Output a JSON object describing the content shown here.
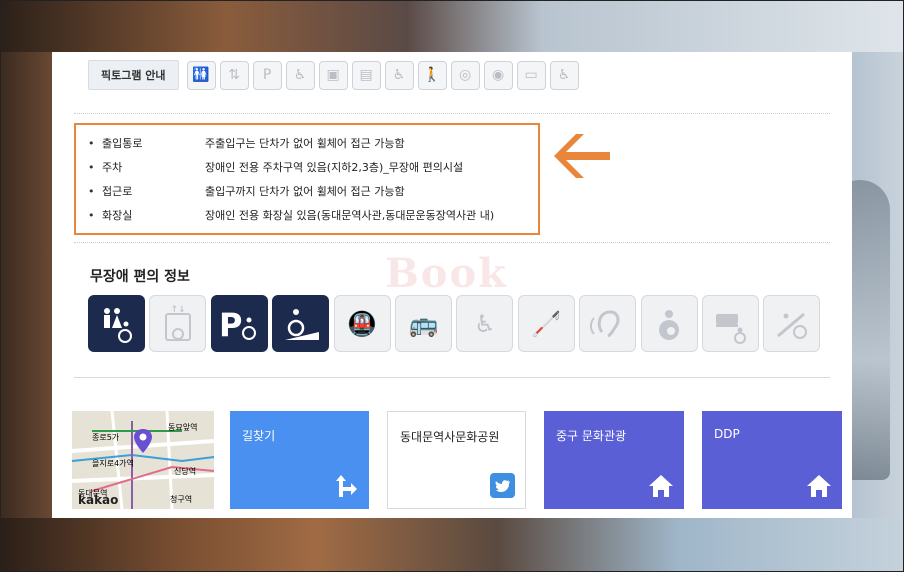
{
  "pictogram": {
    "button_label": "픽토그램 안내",
    "icons": [
      "restroom-icon",
      "elevator-icon",
      "parking-icon",
      "ramp-icon",
      "subway-icon",
      "bus-icon",
      "counter-icon",
      "blind-icon",
      "hearing-icon",
      "nursing-icon",
      "bed-icon",
      "playground-icon"
    ]
  },
  "info": {
    "rows": [
      {
        "label": "출입통로",
        "value": "주출입구는 단차가 없어 휠체어 접근 가능함"
      },
      {
        "label": "주차",
        "value": "장애인 전용 주차구역 있음(지하2,3층)_무장애 편의시설"
      },
      {
        "label": "접근로",
        "value": "출입구까지 단차가 없어 휠체어 접근 가능함"
      },
      {
        "label": "화장실",
        "value": "장애인 전용 화장실 있음(동대문역사관,동대문운동장역사관 내)"
      }
    ]
  },
  "accessibility": {
    "title": "무장애 편의 정보",
    "watermark": "Book",
    "icons": [
      {
        "name": "restroom-icon",
        "active": true,
        "glyph": "🚻"
      },
      {
        "name": "elevator-icon",
        "active": false,
        "glyph": "⇅"
      },
      {
        "name": "parking-icon",
        "active": true,
        "glyph": "P♿"
      },
      {
        "name": "ramp-icon",
        "active": true,
        "glyph": "♿"
      },
      {
        "name": "subway-icon",
        "active": false,
        "glyph": "🚇"
      },
      {
        "name": "bus-icon",
        "active": false,
        "glyph": "🚌"
      },
      {
        "name": "counter-icon",
        "active": false,
        "glyph": "♿"
      },
      {
        "name": "blind-icon",
        "active": false,
        "glyph": "🦯"
      },
      {
        "name": "hearing-icon",
        "active": false,
        "glyph": "👂"
      },
      {
        "name": "nursing-icon",
        "active": false,
        "glyph": "◉"
      },
      {
        "name": "bed-icon",
        "active": false,
        "glyph": "▭"
      },
      {
        "name": "playground-icon",
        "active": false,
        "glyph": "♿"
      }
    ]
  },
  "map": {
    "labels": [
      "동묘앞역",
      "종로5가",
      "을지로4가역",
      "신당역",
      "청구역",
      "동대문역"
    ],
    "brand": "kakao"
  },
  "tiles": {
    "road": "길찾기",
    "park": "동대문역사문화공원",
    "culture": "중구 문화관광",
    "ddp": "DDP"
  },
  "colors": {
    "accent_orange": "#e8873c",
    "navy_active": "#1c2a4e",
    "road_blue": "#4a90f0",
    "tile_purple": "#5a5fd6"
  }
}
